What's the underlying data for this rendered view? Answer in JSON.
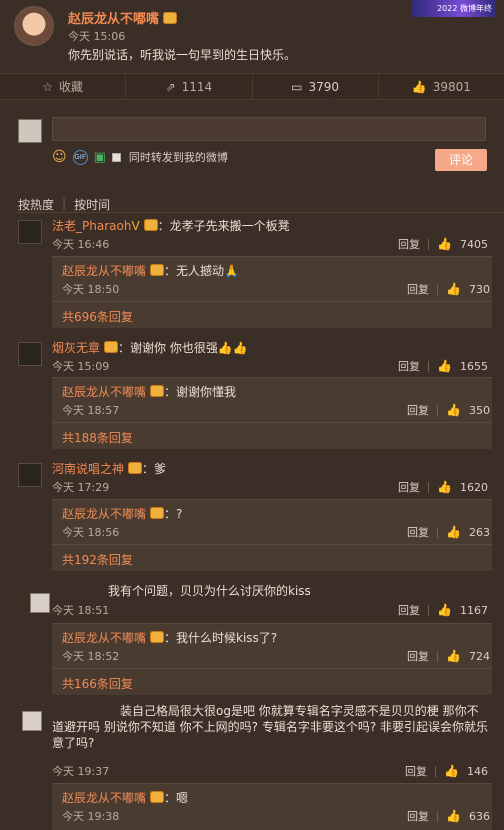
{
  "post": {
    "author": "赵辰龙从不嘟嘴",
    "time": "今天 15:06",
    "text": "你先别说话，听我说一句早到的生日快乐。",
    "banner": "2022 微博年终"
  },
  "actions": [
    {
      "icon": "☆",
      "label": "收藏"
    },
    {
      "icon": "⇗",
      "label": "1114"
    },
    {
      "icon": "▭",
      "label": "3790"
    },
    {
      "icon": "👍",
      "label": "39801"
    }
  ],
  "compose": {
    "forward_label": "同时转发到我的微博",
    "submit_label": "评论",
    "gif_label": "GIF"
  },
  "sort": {
    "hot": "按热度",
    "time": "按时间"
  },
  "labels": {
    "reply": "回复",
    "colon": "："
  },
  "comments": [
    {
      "user": "法老_Pharaoh",
      "badge": "V",
      "text": "：龙孝子先来搬一个板凳",
      "time": "今天 16:46",
      "likes": "7405",
      "hot": true,
      "reply": {
        "user": "赵辰龙从不嘟嘴",
        "text": "：无人撼动🙏",
        "time": "今天 18:50",
        "likes": "730",
        "more": "共696条回复"
      }
    },
    {
      "user": "烟灰无章",
      "text": "：谢谢你 你也很强👍👍",
      "time": "今天 15:09",
      "likes": "1655",
      "reply": {
        "user": "赵辰龙从不嘟嘴",
        "text": "：谢谢你懂我",
        "time": "今天 18:57",
        "likes": "350",
        "more": "共188条回复"
      }
    },
    {
      "user": "河南说唱之神",
      "text": "：爹",
      "time": "今天 17:29",
      "likes": "1620",
      "reply": {
        "user": "赵辰龙从不嘟嘴",
        "text": "：?",
        "time": "今天 18:56",
        "likes": "263",
        "more": "共192条回复"
      }
    },
    {
      "user": "",
      "text": "我有个问题，贝贝为什么讨厌你的kiss",
      "time": "今天 18:51",
      "likes": "1167",
      "reply": {
        "user": "赵辰龙从不嘟嘴",
        "text": "：我什么时候kiss了?",
        "time": "今天 18:52",
        "likes": "724",
        "more": "共166条回复"
      }
    },
    {
      "user": "",
      "text": "装自己格局很大很og是吧 你就算专辑名字灵感不是贝贝的梗 那你不道避开吗 别说你不知道 你不上网的吗? 专辑名字非要这个吗? 非要引起误会你就乐意了吗?",
      "time": "今天 19:37",
      "likes": "146",
      "reply": {
        "user": "赵辰龙从不嘟嘴",
        "text": "：嗯",
        "time": "今天 19:38",
        "likes": "636"
      }
    }
  ]
}
